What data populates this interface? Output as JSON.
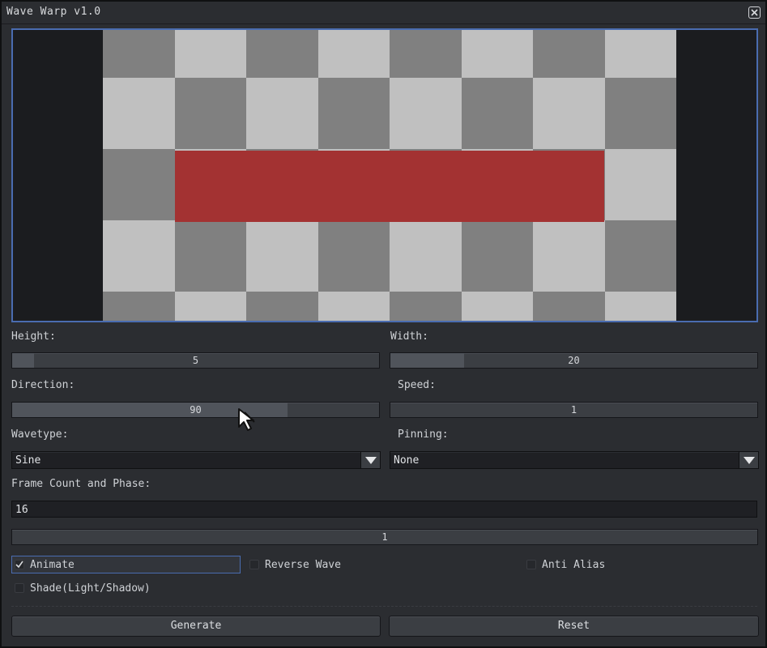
{
  "window": {
    "title": "Wave Warp v1.0",
    "close_icon": "close-icon"
  },
  "preview": {
    "checker_light": "#c0c0c0",
    "checker_dark": "#808080",
    "band_color": "#a33232"
  },
  "controls": {
    "height": {
      "label": "Height:",
      "value": "5",
      "fraction": 0.06
    },
    "width": {
      "label": "Width:",
      "value": "20",
      "fraction": 0.2
    },
    "direction": {
      "label": "Direction:",
      "value": "90",
      "fraction": 0.75
    },
    "speed": {
      "label": "Speed:",
      "value": "1",
      "fraction": 0.0
    },
    "wavetype": {
      "label": "Wavetype:",
      "value": "Sine"
    },
    "pinning": {
      "label": "Pinning:",
      "value": "None"
    },
    "frames": {
      "label": "Frame Count and Phase:",
      "count": "16",
      "phase": "1",
      "phase_fraction": 0.0
    }
  },
  "options": {
    "animate": {
      "label": "Animate",
      "checked": true
    },
    "reverse_wave": {
      "label": "Reverse Wave",
      "checked": false
    },
    "anti_alias": {
      "label": "Anti Alias",
      "checked": false
    },
    "shade": {
      "label": "Shade(Light/Shadow)",
      "checked": false
    }
  },
  "buttons": {
    "generate": "Generate",
    "reset": "Reset"
  },
  "colors": {
    "accent": "#4a6cb0",
    "window_bg": "#2b2d31"
  }
}
